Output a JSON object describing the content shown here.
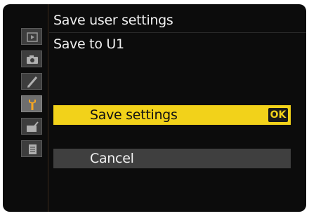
{
  "menu": {
    "title": "Save user settings",
    "subtitle": "Save to U1"
  },
  "sidebar": {
    "items": [
      {
        "icon": "playback-icon",
        "active": false
      },
      {
        "icon": "camera-icon",
        "active": false
      },
      {
        "icon": "pencil-icon",
        "active": false
      },
      {
        "icon": "wrench-icon",
        "active": true
      },
      {
        "icon": "retouch-icon",
        "active": false
      },
      {
        "icon": "my-menu-icon",
        "active": false
      }
    ]
  },
  "options": [
    {
      "label": "Save settings",
      "selected": true,
      "badge": "OK"
    },
    {
      "label": "Cancel",
      "selected": false
    }
  ],
  "colors": {
    "highlight": "#f2d21a",
    "active_icon": "#f5a623",
    "background": "#0c0c0c"
  }
}
